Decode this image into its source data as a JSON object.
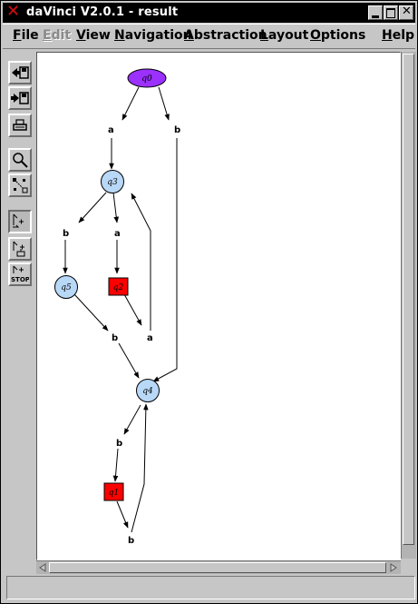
{
  "window": {
    "title": "daVinci V2.0.1 - result"
  },
  "menu": {
    "file": {
      "first": "F",
      "rest": "ile"
    },
    "edit": {
      "first": "E",
      "rest": "dit"
    },
    "view": {
      "first": "V",
      "rest": "iew"
    },
    "navigation": {
      "first": "N",
      "rest": "avigation"
    },
    "abstraction": {
      "first": "A",
      "rest": "bstraction"
    },
    "layout": {
      "first": "L",
      "rest": "ayout"
    },
    "options": {
      "first": "O",
      "rest": "ptions"
    },
    "help": {
      "first": "H",
      "rest": "elp"
    }
  },
  "toolbar": {
    "icons": [
      "load-graph-icon",
      "save-graph-icon",
      "print-icon",
      "zoom-icon",
      "layout-icon",
      "animation-step-icon",
      "animation-step-up-icon",
      "animation-stop-icon"
    ],
    "stop_label": "STOP"
  },
  "graph": {
    "colors": {
      "start": "#9b30ff",
      "state": "#b8d8f8",
      "final": "#ff0000",
      "edge": "#000000"
    },
    "nodes": {
      "q0": "q0",
      "q3": "q3",
      "q5": "q5",
      "q2": "q2",
      "q4": "q4",
      "q1": "q1"
    },
    "edge_labels": {
      "a": "a",
      "b": "b"
    }
  }
}
